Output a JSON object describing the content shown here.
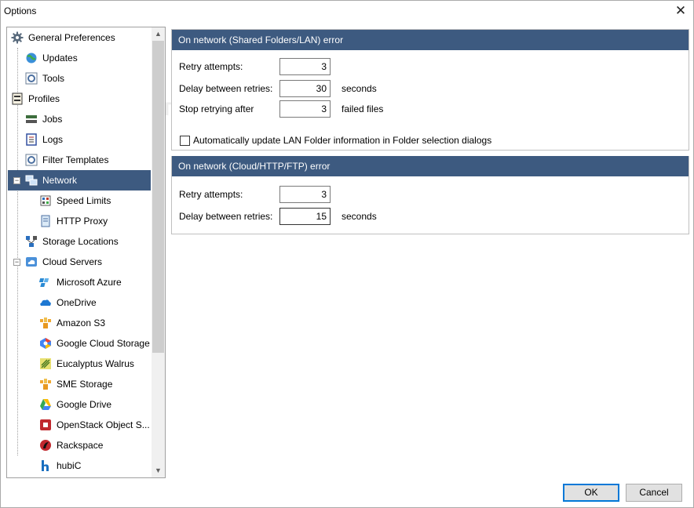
{
  "window": {
    "title": "Options"
  },
  "tree": {
    "items": [
      {
        "label": "General Preferences",
        "icon": "gear-icon"
      },
      {
        "label": "Updates",
        "icon": "globe-icon"
      },
      {
        "label": "Tools",
        "icon": "tools-icon"
      },
      {
        "label": "Profiles",
        "icon": "profile-icon"
      },
      {
        "label": "Jobs",
        "icon": "jobs-icon"
      },
      {
        "label": "Logs",
        "icon": "log-icon"
      },
      {
        "label": "Filter Templates",
        "icon": "filter-icon"
      },
      {
        "label": "Network",
        "icon": "network-icon"
      },
      {
        "label": "Speed Limits",
        "icon": "speed-icon"
      },
      {
        "label": "HTTP Proxy",
        "icon": "proxy-icon"
      },
      {
        "label": "Storage Locations",
        "icon": "storage-icon"
      },
      {
        "label": "Cloud Servers",
        "icon": "cloud-icon"
      },
      {
        "label": "Microsoft Azure",
        "icon": "azure-icon"
      },
      {
        "label": "OneDrive",
        "icon": "onedrive-icon"
      },
      {
        "label": "Amazon S3",
        "icon": "amazon-s3-icon"
      },
      {
        "label": "Google Cloud Storage",
        "icon": "google-cloud-icon"
      },
      {
        "label": "Eucalyptus Walrus",
        "icon": "eucalyptus-icon"
      },
      {
        "label": "SME Storage",
        "icon": "sme-storage-icon"
      },
      {
        "label": "Google Drive",
        "icon": "google-drive-icon"
      },
      {
        "label": "OpenStack Object S...",
        "icon": "openstack-icon"
      },
      {
        "label": "Rackspace",
        "icon": "rackspace-icon"
      },
      {
        "label": "hubiC",
        "icon": "hubic-icon"
      }
    ]
  },
  "lan_section": {
    "header": "On network (Shared Folders/LAN) error",
    "retry_label": "Retry attempts:",
    "retry_value": "3",
    "delay_label": "Delay between retries:",
    "delay_value": "30",
    "delay_suffix": "seconds",
    "stop_label": "Stop retrying after",
    "stop_value": "3",
    "stop_suffix": "failed files",
    "checkbox_label": "Automatically update LAN Folder information in Folder selection dialogs"
  },
  "cloud_section": {
    "header": "On network (Cloud/HTTP/FTP) error",
    "retry_label": "Retry attempts:",
    "retry_value": "3",
    "delay_label": "Delay between retries:",
    "delay_value": "15",
    "delay_suffix": "seconds"
  },
  "buttons": {
    "ok": "OK",
    "cancel": "Cancel"
  },
  "colors": {
    "selection": "#3d5a80",
    "header": "#3d5a80",
    "default_button_border": "#0078d7"
  }
}
